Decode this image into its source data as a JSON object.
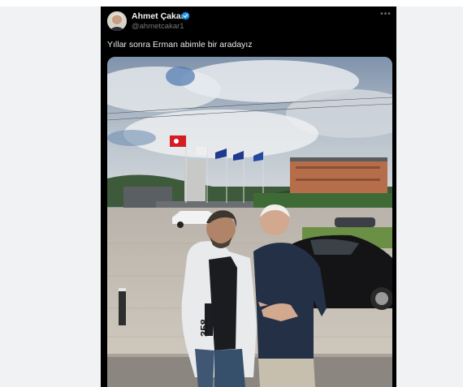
{
  "tweet": {
    "author_name": "Ahmet Çakar",
    "author_handle": "@ahmetcakar1",
    "text": "Yıllar sonra Erman abimle bir aradayız",
    "avatar_icon": "profile-photo",
    "verified_icon": "verified-badge-icon",
    "more_icon": "more-options-icon"
  },
  "photo": {
    "jacket_print": "358"
  },
  "colors": {
    "card_background": "#000000",
    "verified_blue": "#1d9bf0",
    "handle_gray": "#71767b"
  }
}
